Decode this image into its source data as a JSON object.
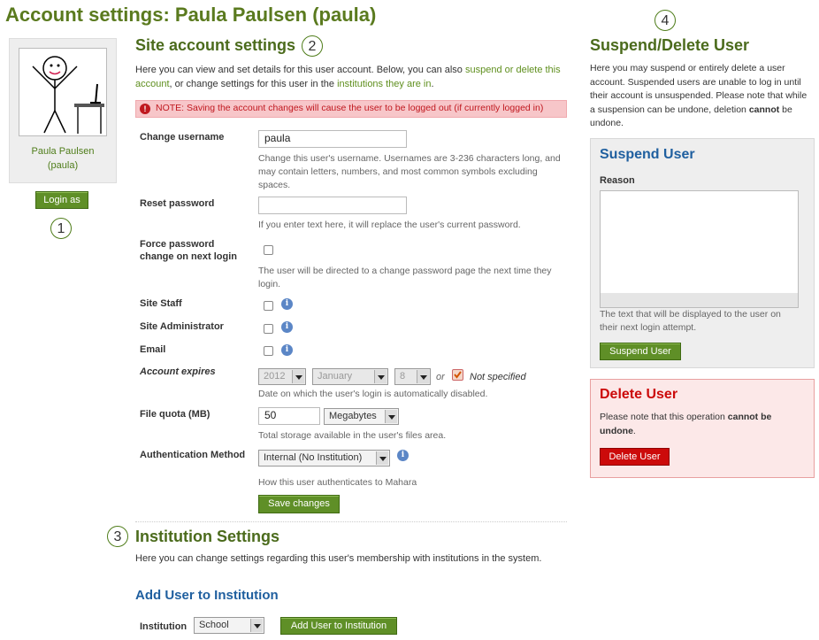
{
  "page": {
    "title": "Account settings: Paula Paulsen (paula)"
  },
  "profile": {
    "name_line1": "Paula Paulsen",
    "name_line2": "(paula)",
    "login_as": "Login as"
  },
  "markers": {
    "m1": "1",
    "m2": "2",
    "m3": "3",
    "m4": "4"
  },
  "site_account": {
    "heading": "Site account settings",
    "intro_1": "Here you can view and set details for this user account. Below, you can also ",
    "intro_link1": "suspend or delete this account",
    "intro_2": ", or change settings for this user in the ",
    "intro_link2": "institutions they are in",
    "intro_3": ".",
    "notice": "NOTE: Saving the account changes will cause the user to be logged out (if currently logged in)",
    "notice_icon": "!",
    "username_label": "Change username",
    "username_value": "paula",
    "username_help": "Change this user's username. Usernames are 3-236 characters long, and may contain letters, numbers, and most common symbols excluding spaces.",
    "reset_label": "Reset password",
    "reset_value": "",
    "reset_help": "If you enter text here, it will replace the user's current password.",
    "force_label": "Force password change on next login",
    "force_help": "The user will be directed to a change password page the next time they login.",
    "staff_label": "Site Staff",
    "admin_label": "Site Administrator",
    "email_label": "Email",
    "info_icon": "i",
    "expires_label": "Account expires",
    "expires_year": "2012",
    "expires_month": "January",
    "expires_day": "8",
    "expires_or": "or",
    "expires_not_specified": "Not specified",
    "expires_help": "Date on which the user's login is automatically disabled.",
    "quota_label": "File quota (MB)",
    "quota_value": "50",
    "quota_unit": "Megabytes",
    "quota_help": "Total storage available in the user's files area.",
    "auth_label": "Authentication Method",
    "auth_value": "Internal (No Institution)",
    "auth_help": "How this user authenticates to Mahara",
    "save_label": "Save changes"
  },
  "institution": {
    "heading": "Institution Settings",
    "intro": "Here you can change settings regarding this user's membership with institutions in the system.",
    "add_heading": "Add User to Institution",
    "inst_label": "Institution",
    "inst_value": "School",
    "add_button": "Add User to Institution"
  },
  "suspend": {
    "heading": "Suspend/Delete User",
    "intro_1": "Here you may suspend or entirely delete a user account. Suspended users are unable to log in until their account is unsuspended. Please note that while a suspension can be undone, deletion ",
    "intro_bold": "cannot",
    "intro_2": " be undone.",
    "panel_heading": "Suspend User",
    "reason_label": "Reason",
    "reason_help": "The text that will be displayed to the user on their next login attempt.",
    "suspend_button": "Suspend User"
  },
  "delete": {
    "heading": "Delete User",
    "text_1": "Please note that this operation ",
    "text_bold": "cannot be undone",
    "text_2": ".",
    "delete_button": "Delete User"
  },
  "colors": {
    "brand_green": "#5a7a1e",
    "heading_blue": "#1f5f9f",
    "danger_red": "#cc0a0a"
  }
}
